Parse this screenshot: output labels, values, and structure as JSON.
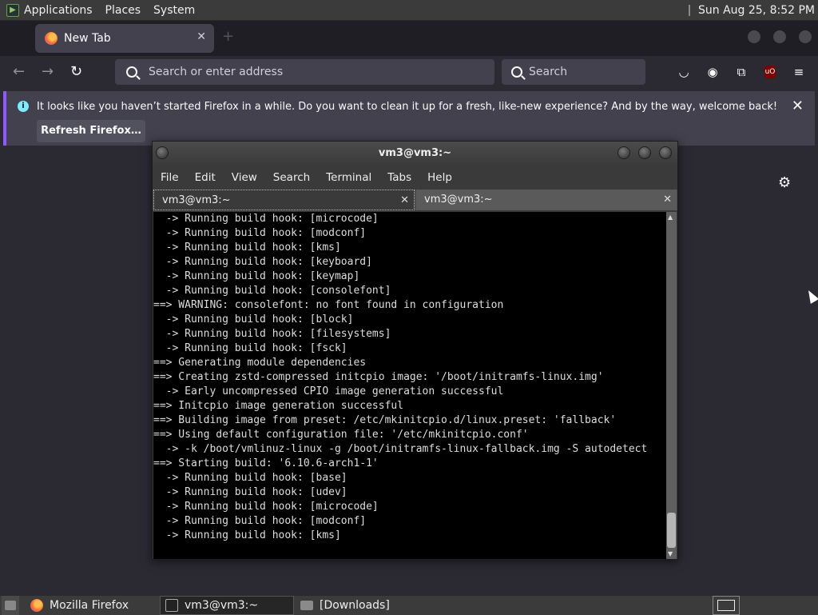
{
  "top_panel": {
    "menus": [
      "Applications",
      "Places",
      "System"
    ],
    "clock": "Sun Aug 25,  8:52 PM"
  },
  "firefox": {
    "tab_title": "New Tab",
    "url_placeholder": "Search or enter address",
    "search_placeholder": "Search",
    "notice_message": "It looks like you haven’t started Firefox in a while. Do you want to clean it up for a fresh, like-new experience? And by the way, welcome back!",
    "refresh_label": "Refresh Firefox…",
    "ublock_label": "uO"
  },
  "terminal": {
    "title": "vm3@vm3:~",
    "menu": [
      "File",
      "Edit",
      "View",
      "Search",
      "Terminal",
      "Tabs",
      "Help"
    ],
    "tabs": [
      "vm3@vm3:~",
      "vm3@vm3:~"
    ],
    "lines": [
      "  -> Running build hook: [microcode]",
      "  -> Running build hook: [modconf]",
      "  -> Running build hook: [kms]",
      "  -> Running build hook: [keyboard]",
      "  -> Running build hook: [keymap]",
      "  -> Running build hook: [consolefont]",
      "==> WARNING: consolefont: no font found in configuration",
      "  -> Running build hook: [block]",
      "  -> Running build hook: [filesystems]",
      "  -> Running build hook: [fsck]",
      "==> Generating module dependencies",
      "==> Creating zstd-compressed initcpio image: '/boot/initramfs-linux.img'",
      "  -> Early uncompressed CPIO image generation successful",
      "==> Initcpio image generation successful",
      "==> Building image from preset: /etc/mkinitcpio.d/linux.preset: 'fallback'",
      "==> Using default configuration file: '/etc/mkinitcpio.conf'",
      "  -> -k /boot/vmlinuz-linux -g /boot/initramfs-linux-fallback.img -S autodetect",
      "==> Starting build: '6.10.6-arch1-1'",
      "  -> Running build hook: [base]",
      "  -> Running build hook: [udev]",
      "  -> Running build hook: [microcode]",
      "  -> Running build hook: [modconf]",
      "  -> Running build hook: [kms]"
    ]
  },
  "taskbar": {
    "items": [
      "Mozilla Firefox",
      "vm3@vm3:~",
      "[Downloads]"
    ]
  },
  "colors": {
    "firefox_bg": "#2b2a33",
    "notice_accent": "#9059ff",
    "terminal_bg": "#000000",
    "panel_bg": "#3b3b3b"
  }
}
